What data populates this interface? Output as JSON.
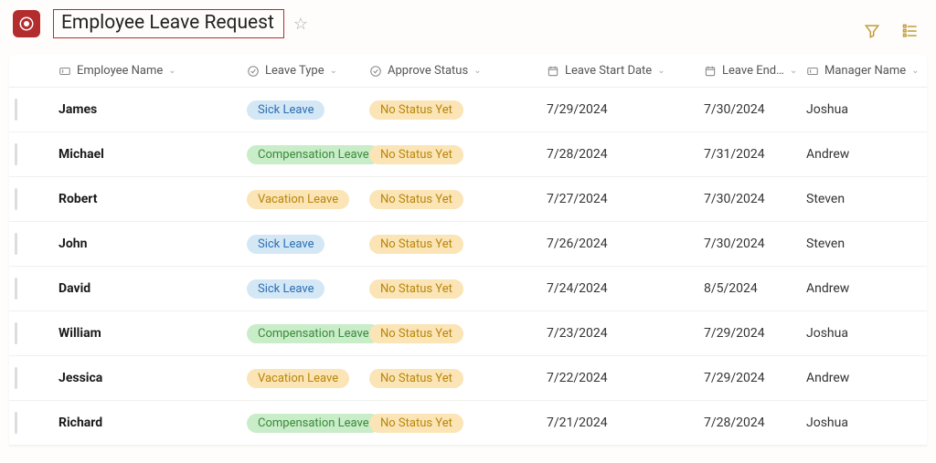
{
  "header": {
    "title": "Employee Leave Request"
  },
  "columns": [
    {
      "label": "Employee Name",
      "icon": "text"
    },
    {
      "label": "Leave Type",
      "icon": "check"
    },
    {
      "label": "Approve Status",
      "icon": "check"
    },
    {
      "label": "Leave Start Date",
      "icon": "date"
    },
    {
      "label": "Leave End…",
      "icon": "date"
    },
    {
      "label": "Manager Name",
      "icon": "text"
    }
  ],
  "leave_type_styles": {
    "Sick Leave": "sick",
    "Compensation Leave": "comp",
    "Vacation Leave": "vac"
  },
  "rows": [
    {
      "name": "James",
      "type": "Sick Leave",
      "status": "No Status Yet",
      "start": "7/29/2024",
      "end": "7/30/2024",
      "manager": "Joshua"
    },
    {
      "name": "Michael",
      "type": "Compensation Leave",
      "status": "No Status Yet",
      "start": "7/28/2024",
      "end": "7/31/2024",
      "manager": "Andrew"
    },
    {
      "name": "Robert",
      "type": "Vacation Leave",
      "status": "No Status Yet",
      "start": "7/27/2024",
      "end": "7/30/2024",
      "manager": "Steven"
    },
    {
      "name": "John",
      "type": "Sick Leave",
      "status": "No Status Yet",
      "start": "7/26/2024",
      "end": "7/30/2024",
      "manager": "Steven"
    },
    {
      "name": "David",
      "type": "Sick Leave",
      "status": "No Status Yet",
      "start": "7/24/2024",
      "end": "8/5/2024",
      "manager": "Andrew"
    },
    {
      "name": "William",
      "type": "Compensation Leave",
      "status": "No Status Yet",
      "start": "7/23/2024",
      "end": "7/29/2024",
      "manager": "Joshua"
    },
    {
      "name": "Jessica",
      "type": "Vacation Leave",
      "status": "No Status Yet",
      "start": "7/22/2024",
      "end": "7/29/2024",
      "manager": "Andrew"
    },
    {
      "name": "Richard",
      "type": "Compensation Leave",
      "status": "No Status Yet",
      "start": "7/21/2024",
      "end": "7/28/2024",
      "manager": "Joshua"
    }
  ]
}
